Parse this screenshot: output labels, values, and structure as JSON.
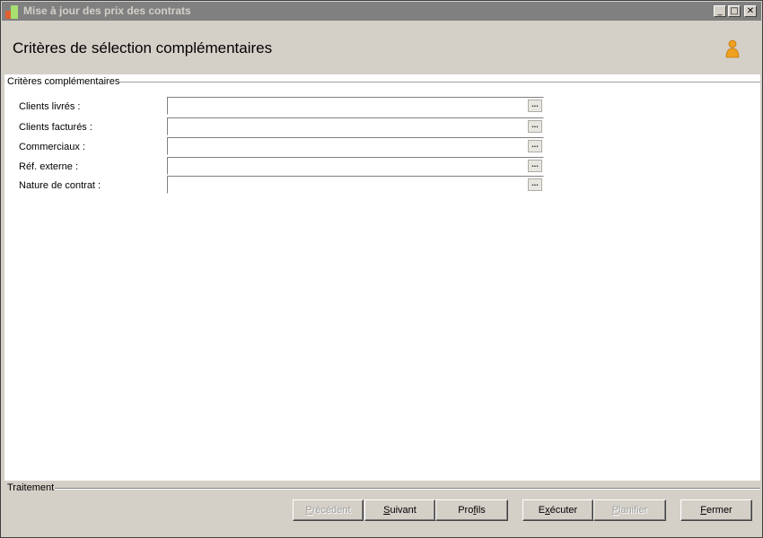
{
  "window": {
    "title": "Mise à jour des prix des contrats",
    "controls": {
      "minimize": "_",
      "maximize": "□",
      "close": "✕"
    }
  },
  "header": {
    "title": "Critères de sélection complémentaires",
    "icon": "user-icon"
  },
  "criteria": {
    "legend": "Critères complémentaires",
    "fields": [
      {
        "label": "Clients livrés :",
        "value": "",
        "button": "..."
      },
      {
        "label": "Clients facturés :",
        "value": "",
        "button": "..."
      },
      {
        "label": "Commerciaux :",
        "value": "",
        "button": "..."
      },
      {
        "label": "Réf. externe :",
        "value": "",
        "button": "..."
      },
      {
        "label": "Nature de contrat :",
        "value": "",
        "button": "..."
      }
    ]
  },
  "footer": {
    "legend": "Traitement",
    "buttons": {
      "previous": {
        "accel": "P",
        "rest": "récédent",
        "enabled": false
      },
      "next": {
        "accel": "S",
        "rest": "uivant",
        "enabled": true
      },
      "profiles": {
        "pre": "Pro",
        "accel": "f",
        "rest": "ils",
        "enabled": true
      },
      "execute": {
        "pre": "E",
        "accel": "x",
        "rest": "écuter",
        "enabled": true
      },
      "schedule": {
        "accel": "P",
        "rest": "lanifier",
        "enabled": false
      },
      "close": {
        "accel": "F",
        "rest": "ermer",
        "enabled": true
      }
    }
  },
  "colors": {
    "titlebar": "#808080",
    "face": "#d4d0c8",
    "accent_icon": "#f0a020"
  }
}
